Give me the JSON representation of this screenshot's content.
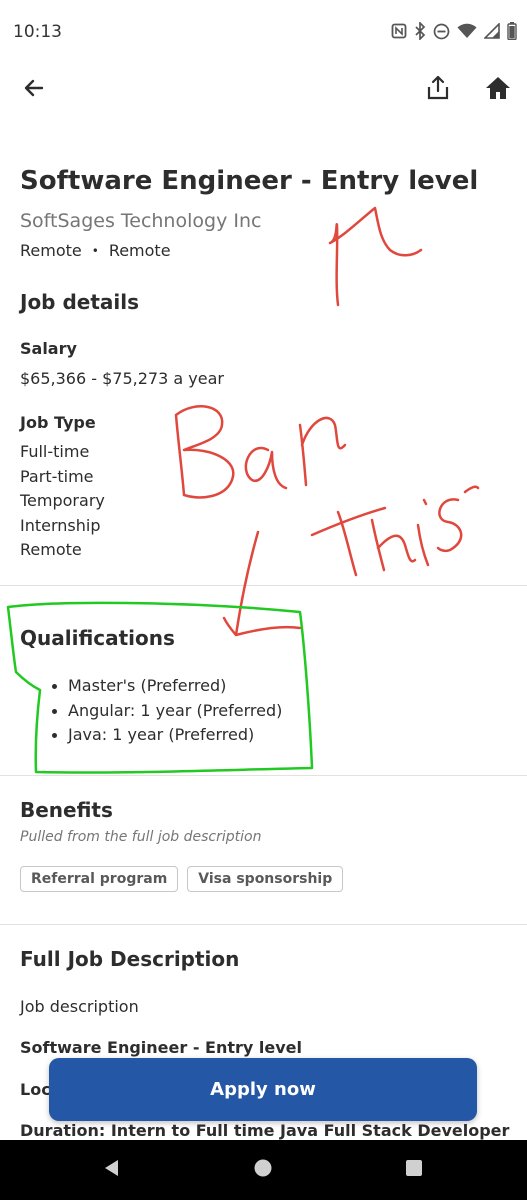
{
  "status_bar": {
    "time": "10:13",
    "icons": [
      "nfc-icon",
      "bluetooth-icon",
      "do-not-disturb-icon",
      "wifi-icon",
      "signal-icon",
      "battery-icon"
    ]
  },
  "app_bar": {
    "icons": [
      "back-arrow-icon",
      "share-icon",
      "home-icon"
    ]
  },
  "job": {
    "title": "Software Engineer - Entry level",
    "company": "SoftSages Technology Inc",
    "location_1": "Remote",
    "location_separator": "•",
    "location_2": "Remote"
  },
  "job_details": {
    "heading": "Job details",
    "salary_label": "Salary",
    "salary_value": "$65,366 - $75,273 a year",
    "job_type_label": "Job Type",
    "job_types": [
      "Full-time",
      "Part-time",
      "Temporary",
      "Internship",
      "Remote"
    ]
  },
  "qualifications": {
    "heading": "Qualifications",
    "items": [
      "Master's (Preferred)",
      "Angular: 1 year (Preferred)",
      "Java: 1 year (Preferred)"
    ]
  },
  "benefits": {
    "heading": "Benefits",
    "note": "Pulled from the full job description",
    "chips": [
      "Referral program",
      "Visa sponsorship"
    ]
  },
  "full_description": {
    "heading": "Full Job Description",
    "line_1": "Job description",
    "line_2": "Software Engineer - Entry level",
    "line_3": "Loc",
    "line_4": "Duration: Intern to Full time Java Full Stack Developer"
  },
  "apply_button": {
    "label": "Apply now"
  },
  "annotations": {
    "text": "Ban This",
    "colors": {
      "red": "#e0483e",
      "green": "#22c922"
    }
  },
  "colors": {
    "primary": "#2557a7",
    "text": "#2d2d2d",
    "muted": "#767676",
    "divider": "#e4e2e0"
  }
}
